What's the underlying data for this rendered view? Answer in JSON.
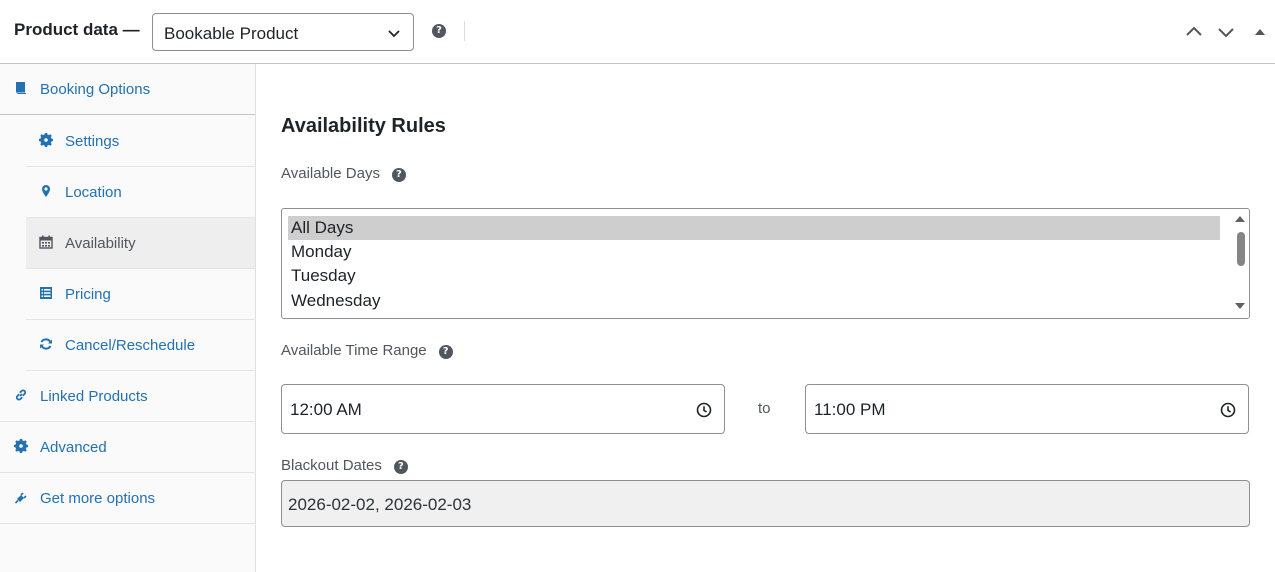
{
  "header": {
    "title": "Product data —",
    "product_type": "Bookable Product",
    "help_symbol": "?"
  },
  "sidebar": {
    "items": [
      {
        "label": "Booking Options",
        "icon": "book-icon"
      },
      {
        "label": "Settings",
        "icon": "gear-icon"
      },
      {
        "label": "Location",
        "icon": "location-pin-icon"
      },
      {
        "label": "Availability",
        "icon": "calendar-icon"
      },
      {
        "label": "Pricing",
        "icon": "list-table-icon"
      },
      {
        "label": "Cancel/Reschedule",
        "icon": "refresh-icon"
      },
      {
        "label": "Linked Products",
        "icon": "link-icon"
      },
      {
        "label": "Advanced",
        "icon": "gear-icon"
      },
      {
        "label": "Get more options",
        "icon": "plugin-icon"
      }
    ],
    "active": "Availability"
  },
  "main": {
    "section_title": "Availability Rules",
    "available_days": {
      "label": "Available Days",
      "options": [
        "All Days",
        "Monday",
        "Tuesday",
        "Wednesday"
      ],
      "selected": "All Days"
    },
    "time_range": {
      "label": "Available Time Range",
      "start": "12:00  AM",
      "separator": "to",
      "end": "11:00  PM"
    },
    "blackout": {
      "label": "Blackout Dates",
      "value": "2026-02-02, 2026-02-03"
    }
  },
  "colors": {
    "link": "#2271b1",
    "active_bg": "#eeeeee",
    "selected_option_bg": "#cecece",
    "readonly_bg": "#f0f0f1"
  }
}
